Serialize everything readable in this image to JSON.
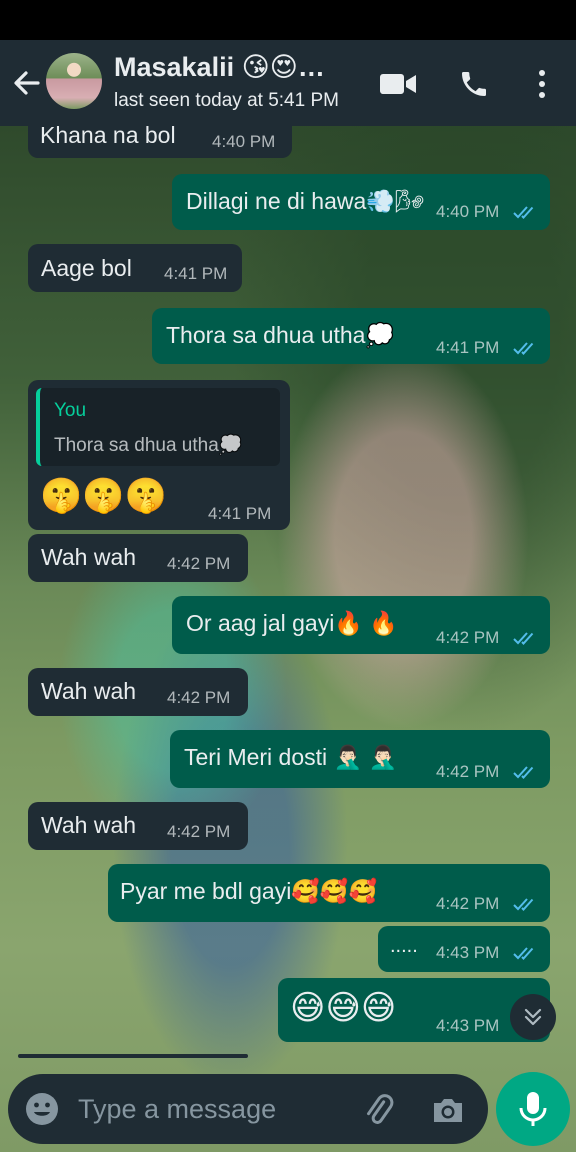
{
  "header": {
    "contact_name": "Masakalii 😘😍…",
    "status": "last seen today at 5:41 PM"
  },
  "messages": [
    {
      "direction": "in",
      "text": "Khana na bol",
      "time": "4:40 PM"
    },
    {
      "direction": "out",
      "text": "Dillagi ne di hawa💨🌬",
      "time": "4:40 PM",
      "status": "read"
    },
    {
      "direction": "in",
      "text": "Aage bol",
      "time": "4:41 PM"
    },
    {
      "direction": "out",
      "text": "Thora sa dhua utha💭",
      "time": "4:41 PM",
      "status": "read"
    },
    {
      "direction": "in",
      "text": "🤫🤫🤫",
      "time": "4:41 PM",
      "reply": {
        "author": "You",
        "text": "Thora sa dhua utha💭"
      }
    },
    {
      "direction": "in",
      "text": "Wah wah",
      "time": "4:42 PM"
    },
    {
      "direction": "out",
      "text": "Or aag jal gayi🔥 🔥",
      "time": "4:42 PM",
      "status": "read"
    },
    {
      "direction": "in",
      "text": "Wah wah",
      "time": "4:42 PM"
    },
    {
      "direction": "out",
      "text": "Teri Meri dosti 🤦🏻‍♂️ 🤦🏻‍♂️",
      "time": "4:42 PM",
      "status": "read"
    },
    {
      "direction": "in",
      "text": "Wah wah",
      "time": "4:42 PM"
    },
    {
      "direction": "out",
      "text": "Pyar me bdl gayi🥰🥰🥰",
      "time": "4:42 PM",
      "status": "read"
    },
    {
      "direction": "out",
      "text": ".....",
      "time": "4:43 PM",
      "status": "read"
    },
    {
      "direction": "out",
      "text": "😅😅😅",
      "time": "4:43 PM"
    }
  ],
  "composer": {
    "placeholder": "Type a message"
  },
  "icons": {
    "back": "arrow-left-icon",
    "video": "video-call-icon",
    "voice": "phone-icon",
    "menu": "more-vert-icon",
    "emoji": "emoji-icon",
    "attach": "paperclip-icon",
    "camera": "camera-icon",
    "mic": "mic-icon",
    "scroll": "chevrons-down-icon",
    "read": "double-check-icon"
  },
  "colors": {
    "header": "#1f2c34",
    "incoming_bubble": "#1f2c34",
    "outgoing_bubble": "#005c4b",
    "accent": "#00a884",
    "read_tick": "#53bdeb"
  }
}
